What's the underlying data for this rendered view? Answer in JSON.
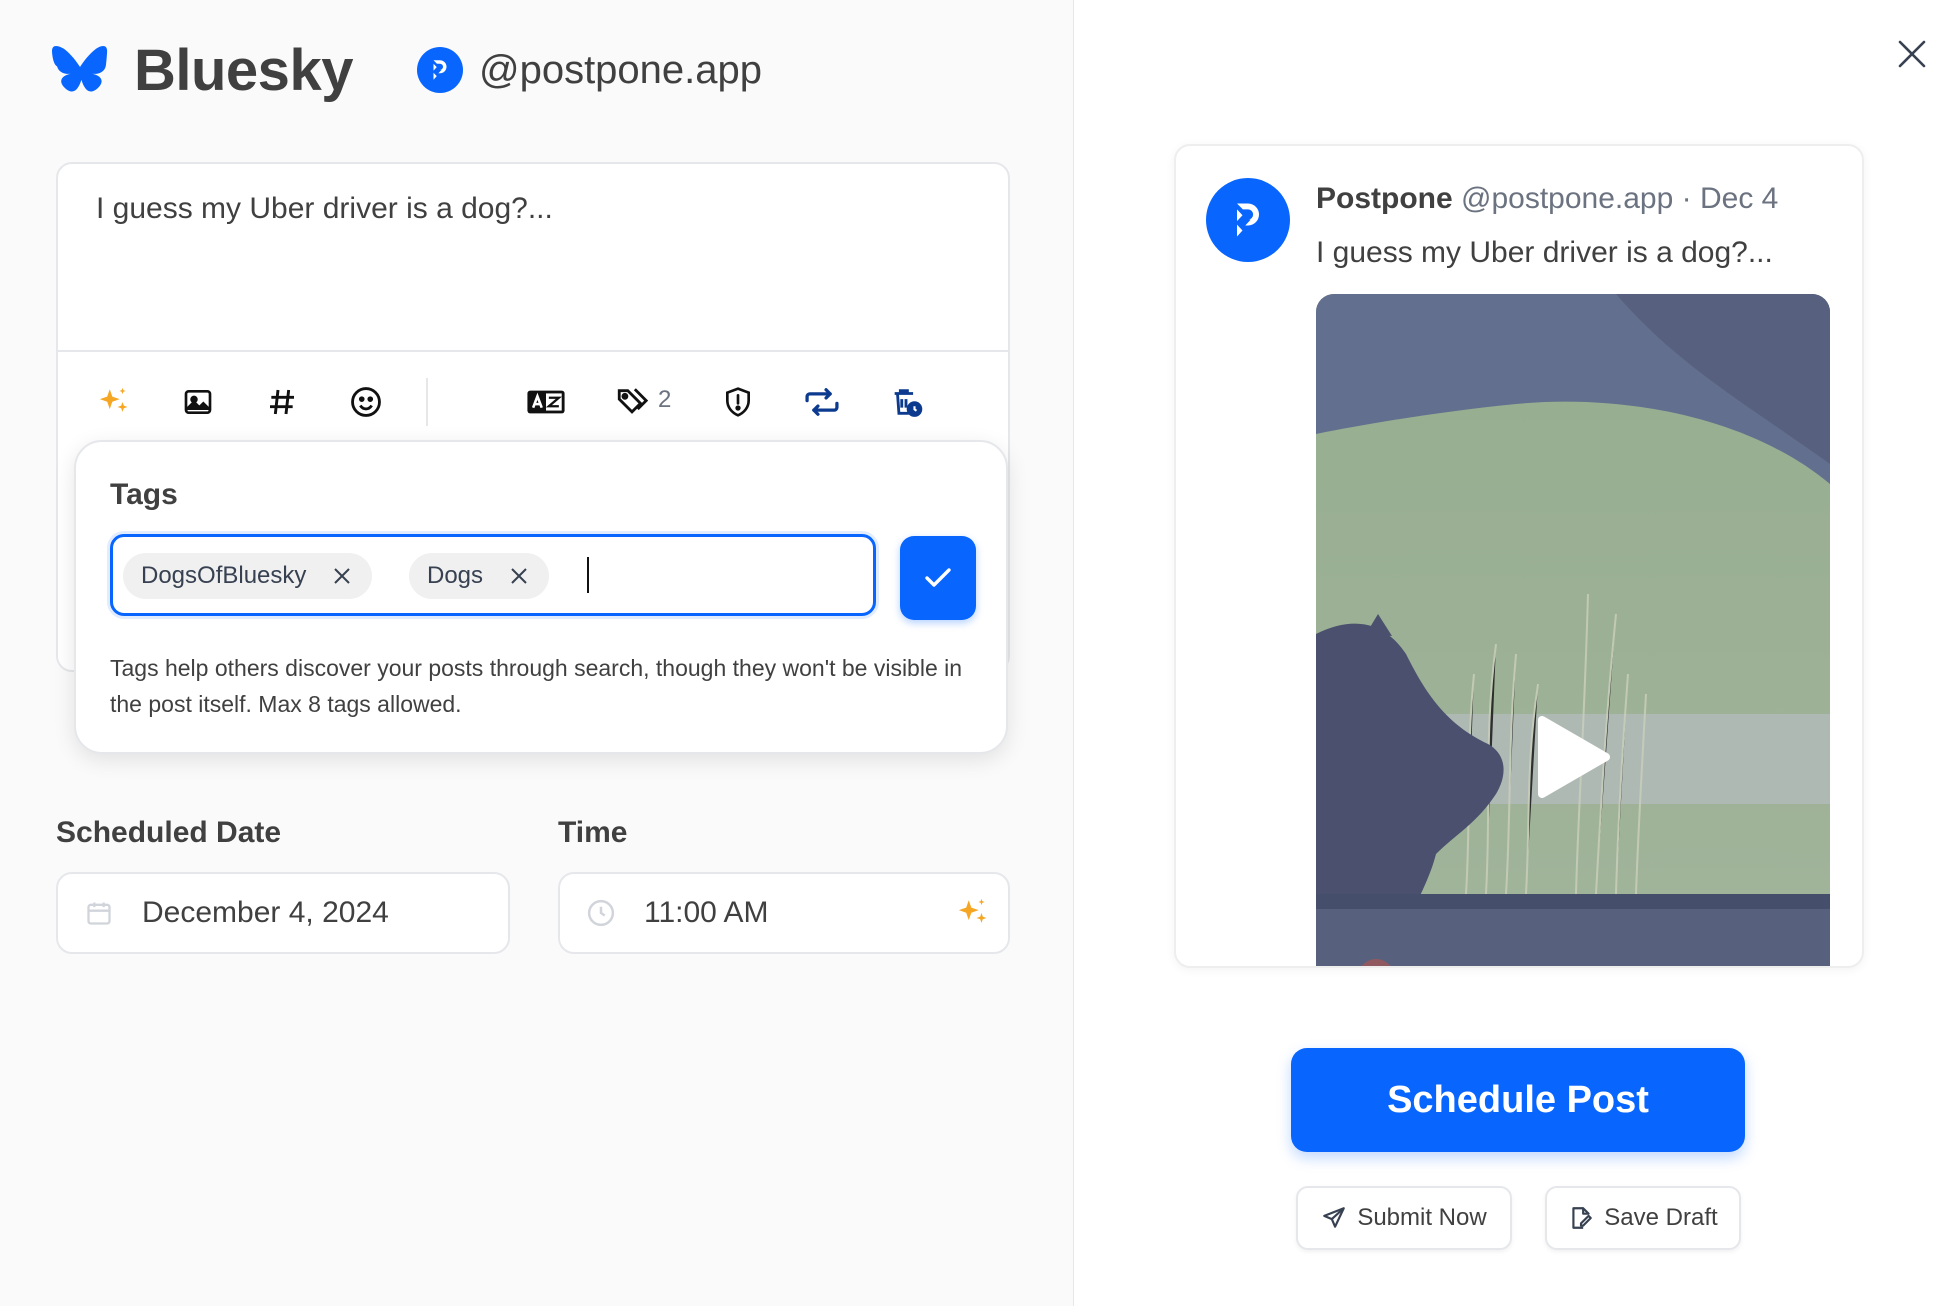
{
  "header": {
    "network": "Bluesky",
    "account_handle": "@postpone.app"
  },
  "composer": {
    "text": "I guess my Uber driver is a dog?...",
    "toolbar": {
      "tags_count": "2"
    }
  },
  "tags_popover": {
    "title": "Tags",
    "tags": [
      "DogsOfBluesky",
      "Dogs"
    ],
    "input_value": "",
    "help_text": "Tags help others discover your posts through search, though they won't be visible in the post itself. Max 8 tags allowed."
  },
  "schedule": {
    "date_label": "Scheduled Date",
    "date_value": "December 4, 2024",
    "time_label": "Time",
    "time_value": "11:00 AM"
  },
  "preview": {
    "name": "Postpone",
    "handle": "@postpone.app",
    "separator": " · ",
    "date": "Dec 4",
    "text": "I guess my Uber driver is a dog?..."
  },
  "actions": {
    "schedule_label": "Schedule Post",
    "submit_label": "Submit Now",
    "draft_label": "Save Draft"
  },
  "colors": {
    "brand_blue": "#0866ff",
    "sparkle": "#f5a623",
    "border": "#e5e7eb"
  }
}
